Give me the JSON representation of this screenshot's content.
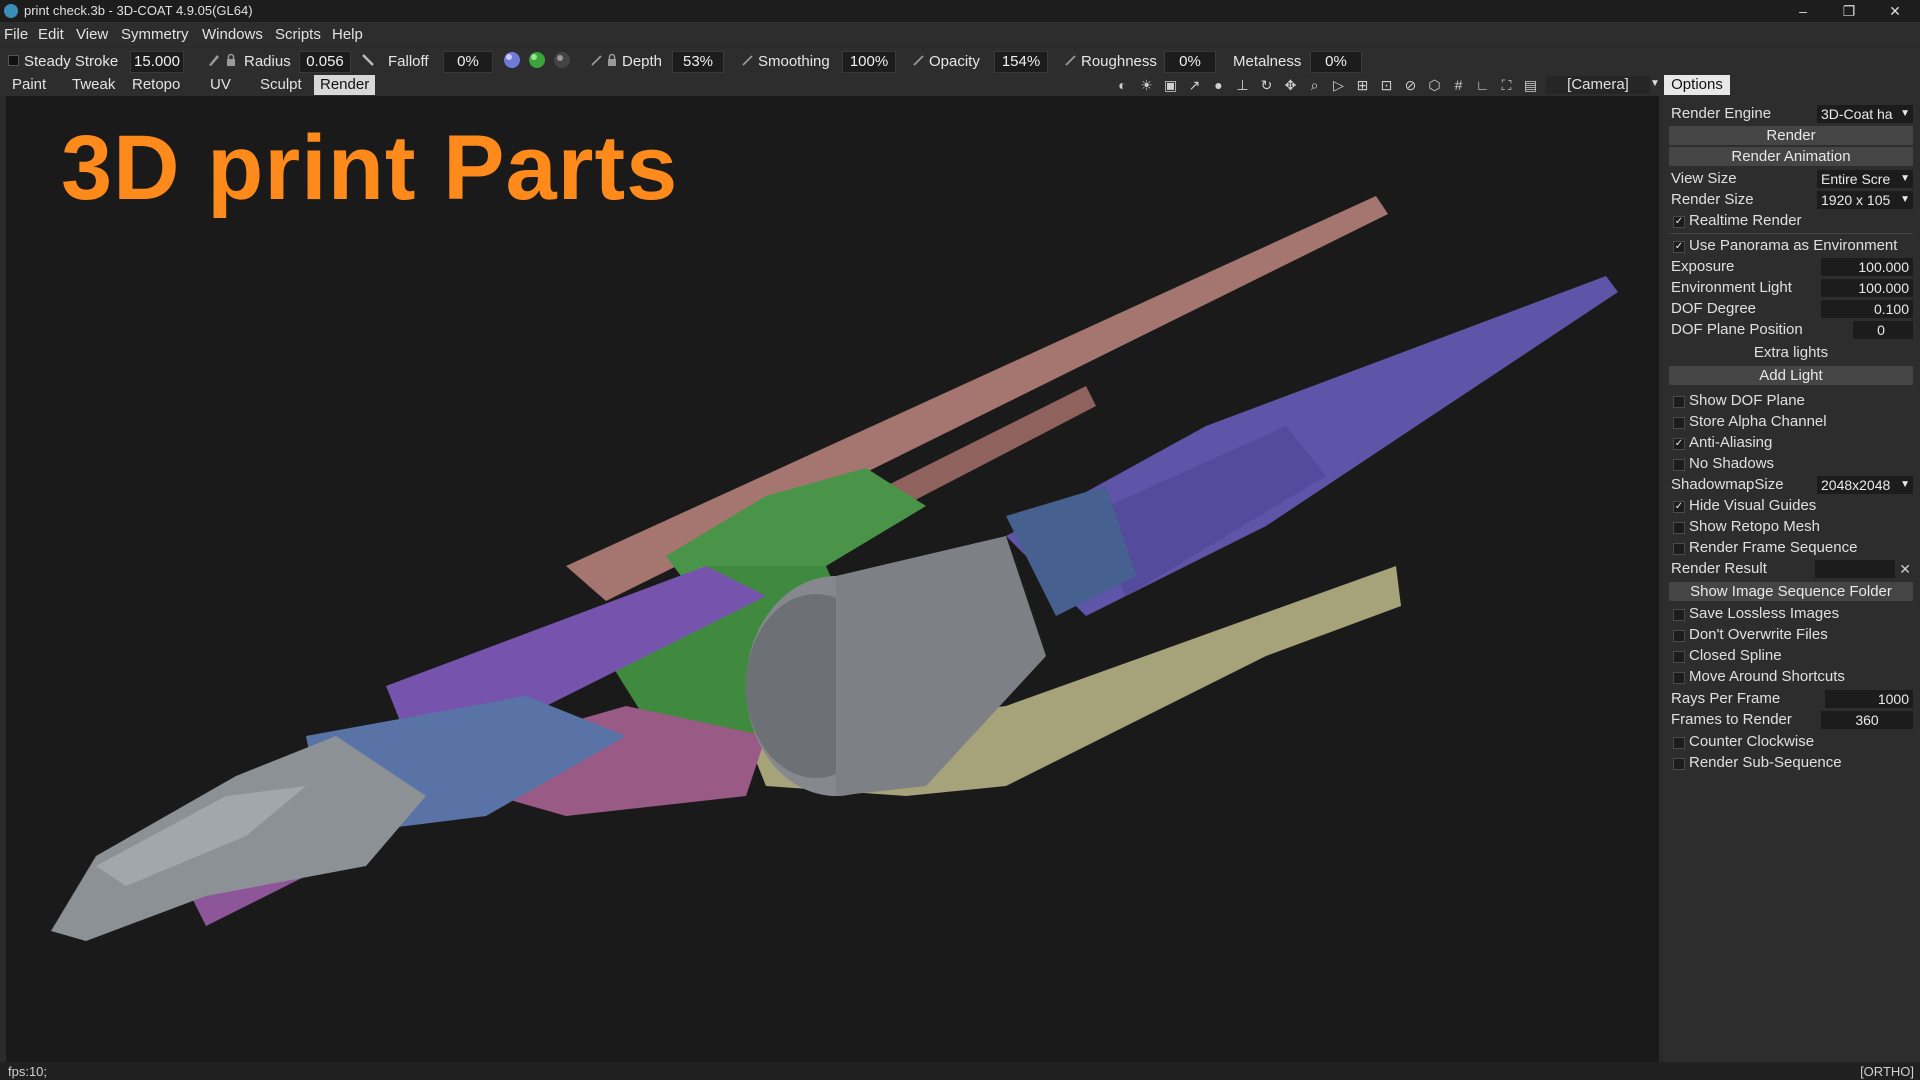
{
  "titlebar": {
    "title": "print check.3b - 3D-COAT 4.9.05(GL64)",
    "minimize": "–",
    "restore": "❐",
    "close": "✕"
  },
  "menu": [
    "File",
    "Edit",
    "View",
    "Symmetry",
    "Windows",
    "Scripts",
    "Help"
  ],
  "tool": {
    "steady_stroke_label": "Steady  Stroke",
    "steady_stroke_value": "15.000",
    "radius_label": "Radius",
    "radius_value": "0.056",
    "falloff_label": "Falloff",
    "falloff_value": "0%",
    "depth_label": "Depth",
    "depth_value": "53%",
    "smoothing_label": "Smoothing",
    "smoothing_value": "100%",
    "opacity_label": "Opacity",
    "opacity_value": "154%",
    "roughness_label": "Roughness",
    "roughness_value": "0%",
    "metalness_label": "Metalness",
    "metalness_value": "0%"
  },
  "tabs": [
    "Paint",
    "Tweak",
    "Retopo",
    "UV",
    "Sculpt",
    "Render"
  ],
  "active_tab": "Render",
  "camera_label": "[Camera]",
  "viewport": {
    "overlay_title": "3D print Parts"
  },
  "panel": {
    "tab": "Options",
    "render_engine_label": "Render  Engine",
    "render_engine_value": "3D-Coat  ha",
    "render_button": "Render",
    "render_animation_button": "Render  Animation",
    "view_size_label": "View  Size",
    "view_size_value": "Entire  Scre",
    "render_size_label": "Render  Size",
    "render_size_value": "1920  x  105",
    "realtime_render": "Realtime  Render",
    "use_panorama": "Use  Panorama  as  Environment",
    "exposure_label": "Exposure",
    "exposure_value": "100.000",
    "env_light_label": "Environment  Light",
    "env_light_value": "100.000",
    "dof_degree_label": "DOF  Degree",
    "dof_degree_value": "0.100",
    "dof_plane_label": "DOF  Plane  Position",
    "dof_plane_value": "0",
    "extra_lights": "Extra  lights",
    "add_light": "Add  Light",
    "show_dof_plane": "Show  DOF  Plane",
    "store_alpha": "Store  Alpha  Channel",
    "anti_aliasing": "Anti-Aliasing",
    "no_shadows": "No  Shadows",
    "shadowmap_label": "ShadowmapSize",
    "shadowmap_value": "2048x2048",
    "hide_guides": "Hide  Visual  Guides",
    "show_retopo": "Show  Retopo  Mesh",
    "render_frame_seq": "Render  Frame  Sequence",
    "render_result_label": "Render  Result",
    "show_image_seq": "Show  Image  Sequence  Folder",
    "save_lossless": "Save  Lossless  Images",
    "dont_overwrite": "Don't  Overwrite  Files",
    "closed_spline": "Closed  Spline",
    "move_around": "Move  Around  Shortcuts",
    "rays_label": "Rays  Per  Frame",
    "rays_value": "1000",
    "frames_label": "Frames  to  Render",
    "frames_value": "360",
    "counter_clockwise": "Counter  Clockwise",
    "render_sub_seq": "Render  Sub-Sequence",
    "checks": {
      "realtime_render": true,
      "use_panorama": true,
      "show_dof_plane": false,
      "store_alpha": false,
      "anti_aliasing": true,
      "no_shadows": false,
      "hide_guides": true,
      "show_retopo": false,
      "render_frame_seq": false,
      "save_lossless": false,
      "dont_overwrite": false,
      "closed_spline": false,
      "move_around": false,
      "counter_clockwise": false,
      "render_sub_seq": false
    }
  },
  "status": {
    "fps": "fps:10;",
    "projection": "[ORTHO]"
  },
  "colors": {
    "accent_title": "#ff8a1c",
    "ship_gray": "#8e9398",
    "ship_blue": "#5d78a8",
    "ship_purple": "#6b5fb0",
    "ship_violet": "#8a5aa8",
    "ship_pink": "#b07a78",
    "ship_green": "#4f9a4f",
    "ship_khaki": "#a8a47a",
    "ship_magenta": "#9a5a8a"
  }
}
